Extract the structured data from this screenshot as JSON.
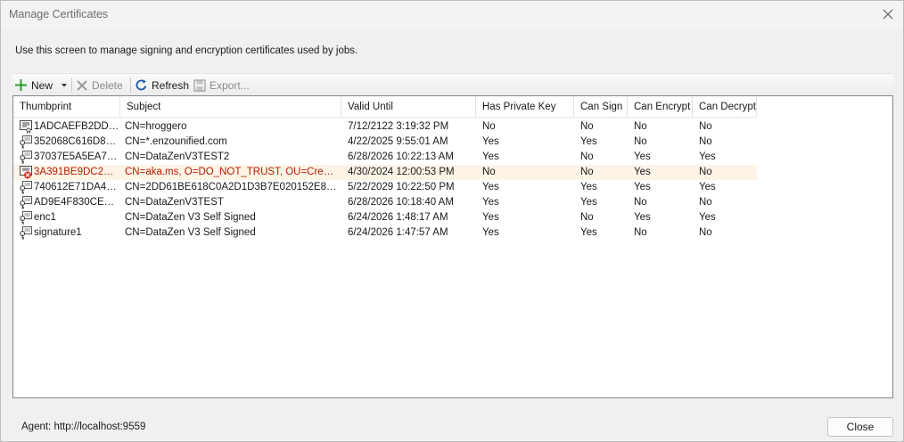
{
  "window": {
    "title": "Manage Certificates"
  },
  "description": "Use this screen to manage signing and encryption certificates used by jobs.",
  "toolbar": {
    "new_label": "New",
    "delete_label": "Delete",
    "refresh_label": "Refresh",
    "export_label": "Export..."
  },
  "grid": {
    "columns": [
      "Thumbprint",
      "Subject",
      "Valid Until",
      "Has Private Key",
      "Can Sign",
      "Can Encrypt",
      "Can Decrypt"
    ],
    "rows": [
      {
        "icon": "certificate-icon",
        "thumbprint": "1ADCAEFB2DDF...",
        "subject": "CN=hroggero",
        "valid_until": "7/12/2122 3:19:32 PM",
        "has_private_key": "No",
        "can_sign": "No",
        "can_encrypt": "No",
        "can_decrypt": "No"
      },
      {
        "icon": "key-certificate-icon",
        "thumbprint": "352068C616D8E...",
        "subject": "CN=*.enzounified.com",
        "valid_until": "4/22/2025 9:55:01 AM",
        "has_private_key": "Yes",
        "can_sign": "Yes",
        "can_encrypt": "No",
        "can_decrypt": "No"
      },
      {
        "icon": "key-certificate-icon",
        "thumbprint": "37037E5A5EA71...",
        "subject": "CN=DataZenV3TEST2",
        "valid_until": "6/28/2026 10:22:13 AM",
        "has_private_key": "Yes",
        "can_sign": "No",
        "can_encrypt": "Yes",
        "can_decrypt": "Yes"
      },
      {
        "icon": "expired-certificate-icon",
        "thumbprint": "3A391BE9DC2B9...",
        "subject": "CN=aka.ms, O=DO_NOT_TRUST, OU=Created...",
        "valid_until": "4/30/2024 12:00:53 PM",
        "has_private_key": "No",
        "can_sign": "No",
        "can_encrypt": "Yes",
        "can_decrypt": "No",
        "selected": true
      },
      {
        "icon": "key-certificate-icon",
        "thumbprint": "740612E71DA40...",
        "subject": "CN=2DD61BE618C0A2D1D3B7E020152E8098...",
        "valid_until": "5/22/2029 10:22:50 PM",
        "has_private_key": "Yes",
        "can_sign": "Yes",
        "can_encrypt": "Yes",
        "can_decrypt": "Yes"
      },
      {
        "icon": "key-certificate-icon",
        "thumbprint": "AD9E4F830CE38...",
        "subject": "CN=DataZenV3TEST",
        "valid_until": "6/28/2026 10:18:40 AM",
        "has_private_key": "Yes",
        "can_sign": "Yes",
        "can_encrypt": "No",
        "can_decrypt": "No"
      },
      {
        "icon": "key-certificate-icon",
        "thumbprint": "enc1",
        "subject": "CN=DataZen V3 Self Signed",
        "valid_until": "6/24/2026 1:48:17 AM",
        "has_private_key": "Yes",
        "can_sign": "No",
        "can_encrypt": "Yes",
        "can_decrypt": "Yes"
      },
      {
        "icon": "key-certificate-icon",
        "thumbprint": "signature1",
        "subject": "CN=DataZen V3 Self Signed",
        "valid_until": "6/24/2026 1:47:57 AM",
        "has_private_key": "Yes",
        "can_sign": "Yes",
        "can_encrypt": "No",
        "can_decrypt": "No"
      }
    ]
  },
  "footer": {
    "agent_text": "Agent: http://localhost:9559",
    "close_label": "Close"
  },
  "colors": {
    "selected_row": "#fdf4e7",
    "expired_text": "#b51c00",
    "new_icon": "#2e9a2e",
    "refresh_icon": "#1e5aa8"
  }
}
